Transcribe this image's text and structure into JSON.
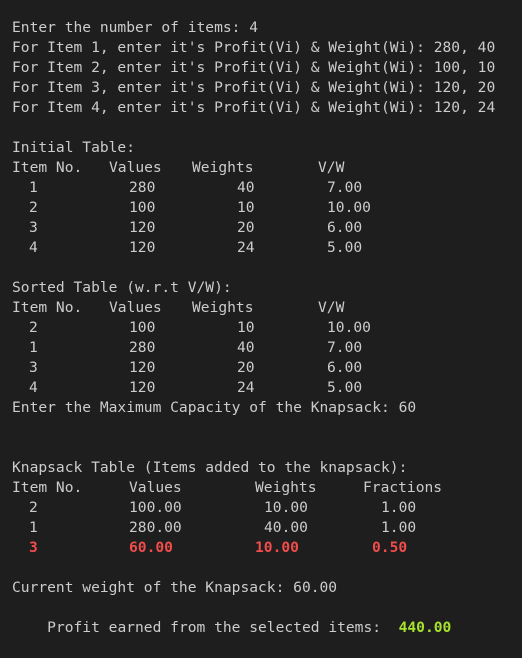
{
  "colors": {
    "background": "#1e1e1e",
    "text": "#cccccc",
    "highlight_red": "#f14c4c",
    "highlight_green": "#a6e22e"
  },
  "prompts": {
    "num_items": "Enter the number of items: 4",
    "items": [
      "For Item 1, enter it's Profit(Vi) & Weight(Wi): 280, 40",
      "For Item 2, enter it's Profit(Vi) & Weight(Wi): 100, 10",
      "For Item 3, enter it's Profit(Vi) & Weight(Wi): 120, 20",
      "For Item 4, enter it's Profit(Vi) & Weight(Wi): 120, 24"
    ]
  },
  "initial_table": {
    "title": "Initial Table:",
    "headers": [
      "Item No.",
      "Values",
      "Weights",
      "V/W"
    ],
    "rows": [
      [
        "1",
        "280",
        "40",
        "7.00"
      ],
      [
        "2",
        "100",
        "10",
        "10.00"
      ],
      [
        "3",
        "120",
        "20",
        "6.00"
      ],
      [
        "4",
        "120",
        "24",
        "5.00"
      ]
    ]
  },
  "sorted_table": {
    "title": "Sorted Table (w.r.t V/W):",
    "headers": [
      "Item No.",
      "Values",
      "Weights",
      "V/W"
    ],
    "rows": [
      [
        "2",
        "100",
        "10",
        "10.00"
      ],
      [
        "1",
        "280",
        "40",
        "7.00"
      ],
      [
        "3",
        "120",
        "20",
        "6.00"
      ],
      [
        "4",
        "120",
        "24",
        "5.00"
      ]
    ]
  },
  "capacity_prompt": "Enter the Maximum Capacity of the Knapsack: 60",
  "knapsack_table": {
    "title": "Knapsack Table (Items added to the knapsack):",
    "headers": [
      "Item No.",
      "Values",
      "Weights",
      "Fractions"
    ],
    "rows": [
      [
        "2",
        "100.00",
        "10.00",
        "1.00"
      ],
      [
        "1",
        "280.00",
        "40.00",
        "1.00"
      ],
      [
        "3",
        "60.00",
        "10.00",
        "0.50"
      ]
    ]
  },
  "summary": {
    "current_weight": "Current weight of the Knapsack: 60.00",
    "profit_label": "Profit earned from the selected items:",
    "profit_value": "440.00"
  }
}
